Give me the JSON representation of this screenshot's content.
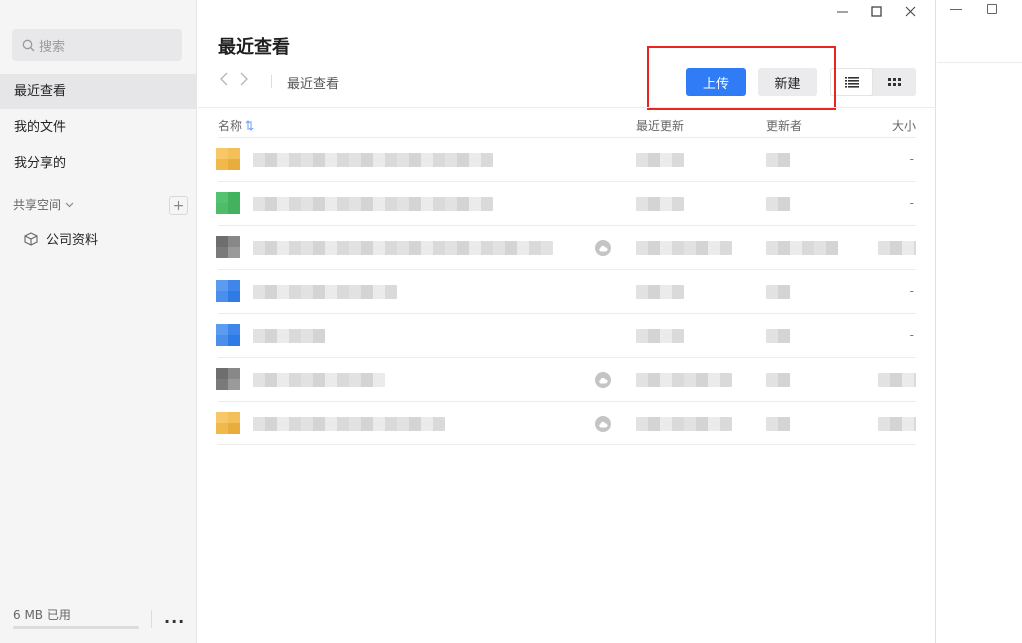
{
  "sidebar": {
    "search_placeholder": "搜索",
    "items": [
      {
        "label": "最近查看",
        "active": true
      },
      {
        "label": "我的文件",
        "active": false
      },
      {
        "label": "我分享的",
        "active": false
      }
    ],
    "section_title": "共享空间",
    "add_label": "+",
    "spaces": [
      {
        "label": "公司资料"
      }
    ],
    "storage_text": "6 MB 已用",
    "storage_fraction": 0.0,
    "more_label": "..."
  },
  "main": {
    "title": "最近查看",
    "breadcrumb": "最近查看",
    "upload_label": "上传",
    "new_label": "新建",
    "columns": {
      "name": "名称",
      "updated": "最近更新",
      "updater": "更新者",
      "size": "大小"
    },
    "rows": [
      {
        "icon": "folder-yellow-icon",
        "cloud": false,
        "size": "-"
      },
      {
        "icon": "sheet-green-icon",
        "cloud": false,
        "size": "-"
      },
      {
        "icon": "file-gray-icon",
        "cloud": true,
        "size": ""
      },
      {
        "icon": "doc-blue-icon",
        "cloud": false,
        "size": "-"
      },
      {
        "icon": "doc-blue-icon",
        "cloud": false,
        "size": "-"
      },
      {
        "icon": "file-gray-icon",
        "cloud": true,
        "size": ""
      },
      {
        "icon": "folder-yellow-icon",
        "cloud": true,
        "size": ""
      }
    ]
  },
  "colors": {
    "accent": "#2f7cf6",
    "highlight": "#e8261f",
    "sidebar_bg": "#f5f5f6"
  }
}
